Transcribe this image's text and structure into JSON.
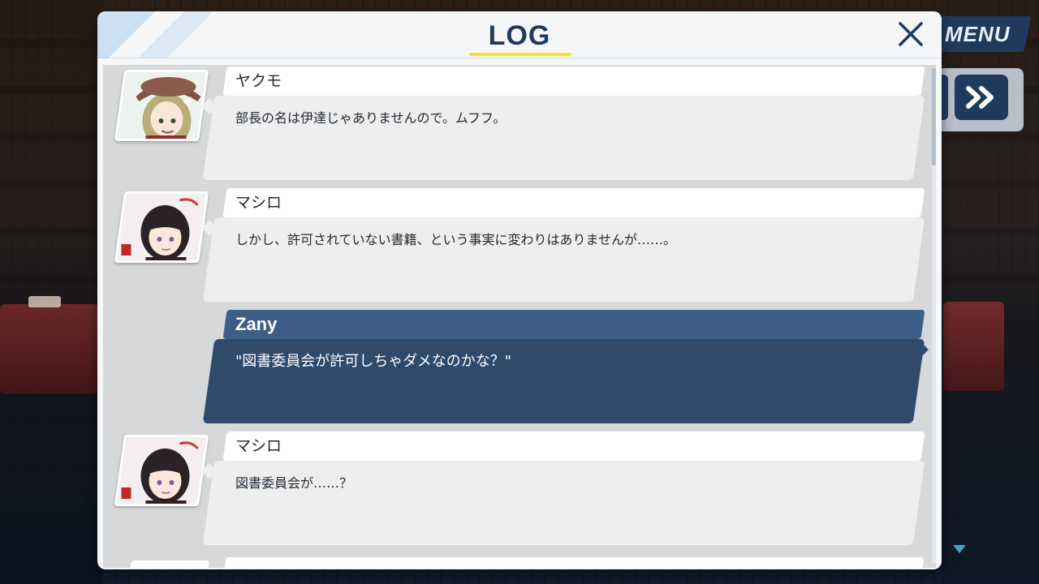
{
  "hud": {
    "menu_label": "MENU",
    "fast_forward_icon": "fast-forward-icon",
    "scroll_indicator_icon": "triangle-down-icon"
  },
  "log": {
    "title": "LOG",
    "close_icon": "close-icon",
    "entries": [
      {
        "speaker": "ヤクモ",
        "text": "部長の名は伊達じゃありませんので。ムフフ。",
        "avatar": "yakumo-portrait",
        "is_player": false
      },
      {
        "speaker": "マシロ",
        "text": "しかし、許可されていない書籍、という事実に変わりはありませんが……。",
        "avatar": "mashiro-portrait",
        "is_player": false
      },
      {
        "speaker": "Zany",
        "text": "\"図書委員会が許可しちゃダメなのかな？\"",
        "avatar": "",
        "is_player": true
      },
      {
        "speaker": "マシロ",
        "text": "図書委員会が……？",
        "avatar": "mashiro-portrait",
        "is_player": false
      }
    ]
  },
  "colors": {
    "accent_yellow": "#f2e22a",
    "title_navy": "#1e3a5f",
    "player_bubble": "#2f4a6b",
    "player_name_bar": "#3d5f87"
  }
}
